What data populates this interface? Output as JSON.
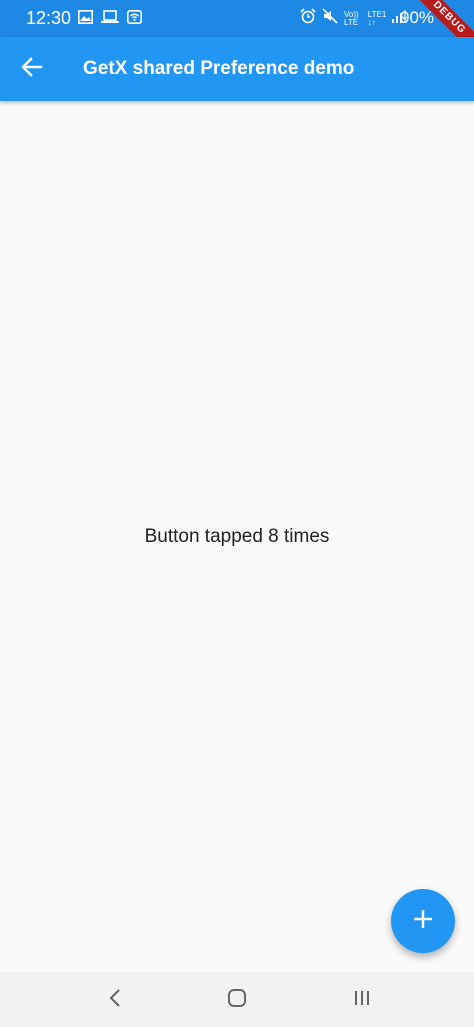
{
  "status_bar": {
    "time": "12:30",
    "net_top": "Vo)) LTE",
    "net_bottom": "LTE1 ↓↑",
    "battery": "90%",
    "debug_label": "DEBUG",
    "icons": [
      "image-icon",
      "laptop-icon",
      "wifi-icon",
      "alarm-icon",
      "mute-icon",
      "signal-icon"
    ]
  },
  "app_bar": {
    "title": "GetX shared Preference demo",
    "back_icon": "arrow-back-icon"
  },
  "main": {
    "counter_text": "Button tapped 8 times"
  },
  "fab": {
    "icon": "plus-icon"
  },
  "nav_bar": {
    "icons": [
      "back-icon",
      "home-icon",
      "recents-icon"
    ]
  },
  "colors": {
    "primary": "#2196f3",
    "status_bar": "#1e88e5",
    "background": "#fafafa",
    "debug_ribbon": "#b71c1c"
  }
}
